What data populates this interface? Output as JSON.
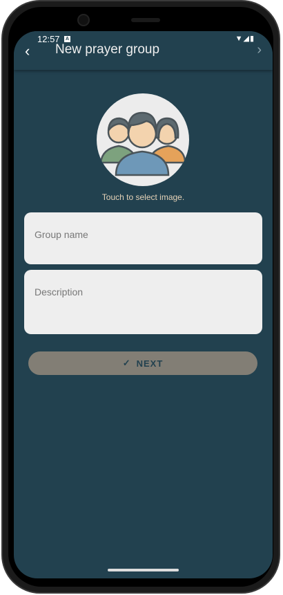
{
  "status": {
    "time": "12:57",
    "notification": "A",
    "icons": "▼◢▮"
  },
  "appbar": {
    "back": "‹",
    "title": "New prayer group",
    "forward": "›"
  },
  "avatar": {
    "hint": "Touch to select image."
  },
  "form": {
    "group_name_placeholder": "Group name",
    "description_placeholder": "Description"
  },
  "next": {
    "icon": "✓",
    "label": "NEXT"
  },
  "colors": {
    "background": "#22414f",
    "button": "#827e75",
    "field": "#eeeeee",
    "hint": "#e6d3b8"
  }
}
